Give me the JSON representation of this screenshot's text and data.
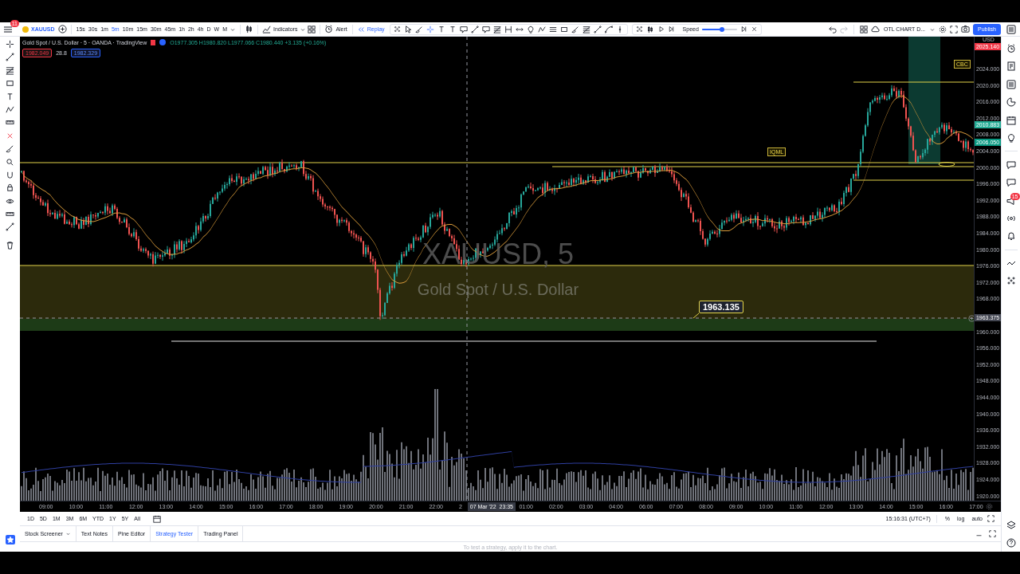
{
  "top_toolbar": {
    "menu_badge": "11",
    "symbol": "XAUUSD",
    "intervals": [
      {
        "label": "15s",
        "selected": false
      },
      {
        "label": "30s",
        "selected": false
      },
      {
        "label": "1m",
        "selected": false
      },
      {
        "label": "5m",
        "selected": true
      },
      {
        "label": "10m",
        "selected": false
      },
      {
        "label": "15m",
        "selected": false
      },
      {
        "label": "30m",
        "selected": false
      },
      {
        "label": "45m",
        "selected": false
      },
      {
        "label": "1h",
        "selected": false
      },
      {
        "label": "2h",
        "selected": false
      },
      {
        "label": "4h",
        "selected": false
      },
      {
        "label": "D",
        "selected": false
      },
      {
        "label": "W",
        "selected": false
      },
      {
        "label": "M",
        "selected": false
      }
    ],
    "indicators": "Indicators",
    "alert": "Alert",
    "replay": "Replay",
    "layout_name": "OTL CHART D...",
    "publish": "Publish"
  },
  "replay_controls": {
    "speed_label": "Speed",
    "speed": {
      "level": 0.57
    }
  },
  "legend": {
    "title": "Gold Spot / U.S. Dollar · 5 · OANDA · TradingView",
    "ohlc": "O1977.305 H1980.820 L1977.066 C1980.440 +3.135 (+0.16%)",
    "bid": "1982.049",
    "spread": "28.8",
    "ask": "1982.329"
  },
  "chart_watermark": {
    "symbol": "XAUUSD, 5",
    "description": "Gold Spot / U.S. Dollar"
  },
  "annotations": [
    {
      "text": "1963.135",
      "kind": "price-note"
    },
    {
      "text": "IQML",
      "kind": "tag"
    },
    {
      "text": "CBC",
      "kind": "tag"
    }
  ],
  "price_axis": {
    "currency": "USD",
    "ticks": [
      "2024.000",
      "2020.000",
      "2016.000",
      "2012.000",
      "2008.000",
      "2004.000",
      "2000.000",
      "1996.000",
      "1992.000",
      "1988.000",
      "1984.000",
      "1980.000",
      "1976.000",
      "1972.000",
      "1968.000",
      "1960.000",
      "1956.000",
      "1952.000",
      "1948.000",
      "1944.000",
      "1940.000",
      "1936.000",
      "1932.000",
      "1928.000",
      "1924.000",
      "1920.000"
    ],
    "badges": [
      {
        "text": "2025.140",
        "color": "#f23645"
      },
      {
        "text": "2010.883",
        "color": "#22ab94"
      },
      {
        "text": "2006.050",
        "color": "#089981"
      },
      {
        "text": "1963.375",
        "color": "#434651"
      }
    ]
  },
  "time_axis": [
    {
      "text": "09:00",
      "kind": "label"
    },
    {
      "text": "10:00",
      "kind": "label"
    },
    {
      "text": "11:00",
      "kind": "label"
    },
    {
      "text": "12:00",
      "kind": "label"
    },
    {
      "text": "13:00",
      "kind": "label"
    },
    {
      "text": "14:00",
      "kind": "label"
    },
    {
      "text": "15:00",
      "kind": "label"
    },
    {
      "text": "16:00",
      "kind": "label"
    },
    {
      "text": "17:00",
      "kind": "label"
    },
    {
      "text": "18:00",
      "kind": "label"
    },
    {
      "text": "19:00",
      "kind": "label"
    },
    {
      "text": "20:00",
      "kind": "label"
    },
    {
      "text": "21:00",
      "kind": "label"
    },
    {
      "text": "22:00",
      "kind": "label"
    },
    {
      "text": "2",
      "kind": "label"
    },
    {
      "text": "07 Mar '22  23:35",
      "kind": "cursor"
    },
    {
      "text": "01:00",
      "kind": "label"
    },
    {
      "text": "02:00",
      "kind": "label"
    },
    {
      "text": "03:00",
      "kind": "label"
    },
    {
      "text": "04:00",
      "kind": "label"
    },
    {
      "text": "06:00",
      "kind": "label"
    },
    {
      "text": "07:00",
      "kind": "label"
    },
    {
      "text": "08:00",
      "kind": "label"
    },
    {
      "text": "09:00",
      "kind": "label"
    },
    {
      "text": "10:00",
      "kind": "label"
    },
    {
      "text": "11:00",
      "kind": "label"
    },
    {
      "text": "12:00",
      "kind": "label"
    },
    {
      "text": "13:00",
      "kind": "label"
    },
    {
      "text": "14:00",
      "kind": "label"
    },
    {
      "text": "15:00",
      "kind": "label"
    },
    {
      "text": "16:00",
      "kind": "label"
    },
    {
      "text": "17:00",
      "kind": "label"
    }
  ],
  "range_bar": {
    "ranges": [
      "1D",
      "5D",
      "1M",
      "3M",
      "6M",
      "YTD",
      "1Y",
      "5Y",
      "All"
    ],
    "clock": "15:16:31 (UTC+7)",
    "options": [
      "%",
      "log",
      "auto"
    ]
  },
  "bottom_tabs": [
    {
      "label": "Stock Screener",
      "selected": false,
      "dropdown": true
    },
    {
      "label": "Text Notes",
      "selected": false,
      "dropdown": false
    },
    {
      "label": "Pine Editor",
      "selected": false,
      "dropdown": false
    },
    {
      "label": "Strategy Tester",
      "selected": true,
      "dropdown": false
    },
    {
      "label": "Trading Panel",
      "selected": false,
      "dropdown": false
    }
  ],
  "message": "To test a strategy, apply it to the chart.",
  "right_sidebar": {
    "badge": "15"
  }
}
